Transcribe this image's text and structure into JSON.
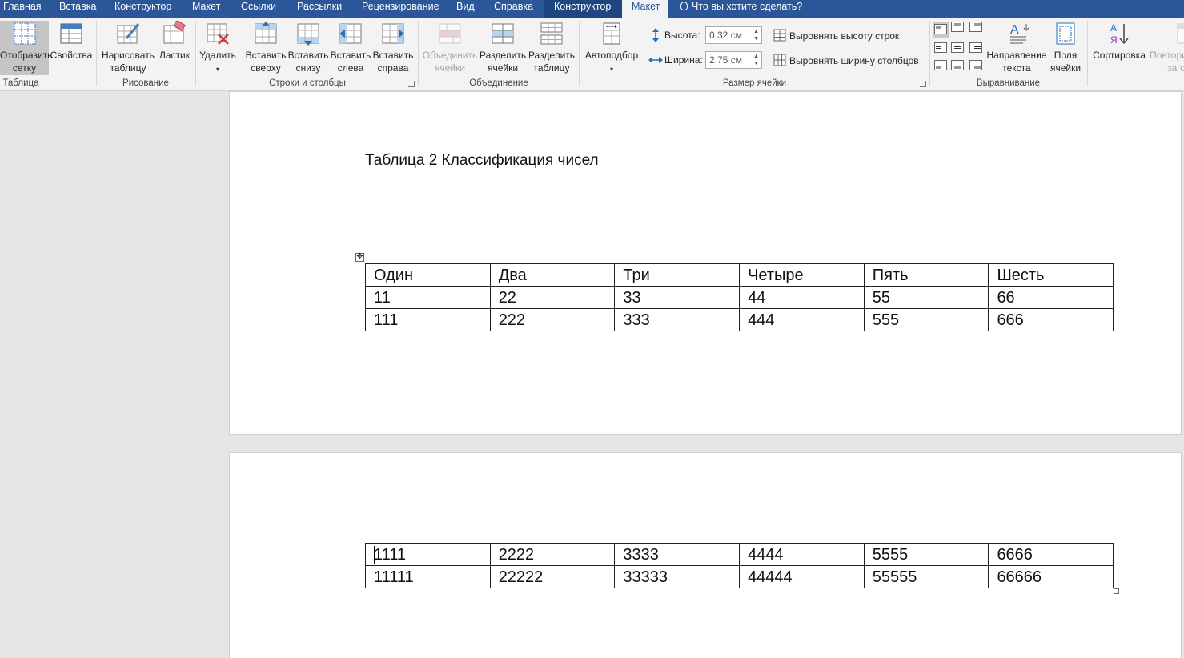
{
  "tabs": [
    {
      "label": "Главная"
    },
    {
      "label": "Вставка"
    },
    {
      "label": "Конструктор"
    },
    {
      "label": "Макет"
    },
    {
      "label": "Ссылки"
    },
    {
      "label": "Рассылки"
    },
    {
      "label": "Рецензирование"
    },
    {
      "label": "Вид"
    },
    {
      "label": "Справка"
    },
    {
      "label": "Конструктор"
    },
    {
      "label": "Макет"
    }
  ],
  "tell_me": "Что вы хотите сделать?",
  "ribbon": {
    "table_group": {
      "label": "Таблица",
      "gridlines_line1": "Отобразить",
      "gridlines_line2": "сетку",
      "properties": "Свойства"
    },
    "draw_group": {
      "label": "Рисование",
      "draw_line1": "Нарисовать",
      "draw_line2": "таблицу",
      "eraser": "Ластик"
    },
    "rows_cols_group": {
      "label": "Строки и столбцы",
      "delete": "Удалить",
      "above_line1": "Вставить",
      "above_line2": "сверху",
      "below_line1": "Вставить",
      "below_line2": "снизу",
      "left_line1": "Вставить",
      "left_line2": "слева",
      "right_line1": "Вставить",
      "right_line2": "справа"
    },
    "merge_group": {
      "label": "Объединение",
      "merge_line1": "Объединить",
      "merge_line2": "ячейки",
      "split_cells_line1": "Разделить",
      "split_cells_line2": "ячейки",
      "split_table_line1": "Разделить",
      "split_table_line2": "таблицу"
    },
    "cell_size_group": {
      "label": "Размер ячейки",
      "autofit": "Автоподбор",
      "height_label": "Высота:",
      "height_value": "0,32 см",
      "width_label": "Ширина:",
      "width_value": "2,75 см",
      "distribute_rows": "Выровнять высоту строк",
      "distribute_cols": "Выровнять ширину столбцов"
    },
    "alignment_group": {
      "label": "Выравнивание",
      "direction_line1": "Направление",
      "direction_line2": "текста",
      "margins_line1": "Поля",
      "margins_line2": "ячейки"
    },
    "data_group": {
      "sort": "Сортировка",
      "repeat_line1": "Повтори",
      "repeat_line2": "загол"
    }
  },
  "document": {
    "caption": "Таблица 2 Классификация чисел",
    "table1": [
      [
        "Один",
        "Два",
        "Три",
        "Четыре",
        "Пять",
        "Шесть"
      ],
      [
        "11",
        "22",
        "33",
        "44",
        "55",
        "66"
      ],
      [
        "111",
        "222",
        "333",
        "444",
        "555",
        "666"
      ]
    ],
    "table2": [
      [
        "1111",
        "2222",
        "3333",
        "4444",
        "5555",
        "6666"
      ],
      [
        "11111",
        "22222",
        "33333",
        "44444",
        "55555",
        "66666"
      ]
    ]
  },
  "colors": {
    "tab_bar": "#2b579a",
    "ribbon_bg": "#f3f3f3",
    "canvas_bg": "#e6e6e6"
  }
}
